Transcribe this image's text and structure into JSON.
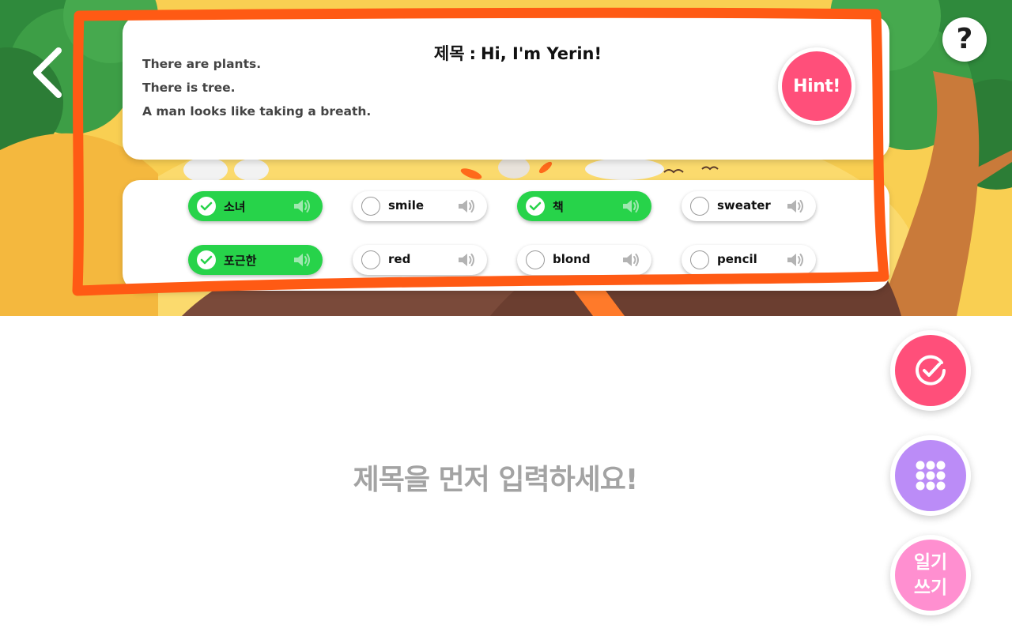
{
  "header": {
    "title_prefix": "제목",
    "title_sep": ":",
    "title_value": "Hi, I'm Yerin!",
    "description_lines": [
      "There are plants.",
      "There is tree.",
      "A man looks like taking a breath."
    ],
    "hint_label": "Hint!",
    "help_label": "?"
  },
  "words": [
    {
      "label": "소녀",
      "selected": true
    },
    {
      "label": "smile",
      "selected": false
    },
    {
      "label": "책",
      "selected": true
    },
    {
      "label": "sweater",
      "selected": false
    },
    {
      "label": "포근한",
      "selected": true
    },
    {
      "label": "red",
      "selected": false
    },
    {
      "label": "blond",
      "selected": false
    },
    {
      "label": "pencil",
      "selected": false
    }
  ],
  "prompt": "제목을 먼저 입력하세요!",
  "actions": {
    "diary_label_line1": "일기",
    "diary_label_line2": "쓰기"
  },
  "icons": {
    "back": "chevron-left-icon",
    "help": "question-mark-icon",
    "speaker": "speaker-icon",
    "check": "check-circle-icon",
    "grid": "grid-icon"
  },
  "colors": {
    "selected_chip": "#27d34a",
    "hint": "#ff4f7a",
    "check_fab": "#ff4f7a",
    "grid_fab": "#bb8cf7",
    "diary_fab": "#ff8fd0",
    "annotation": "#ff5a14"
  }
}
